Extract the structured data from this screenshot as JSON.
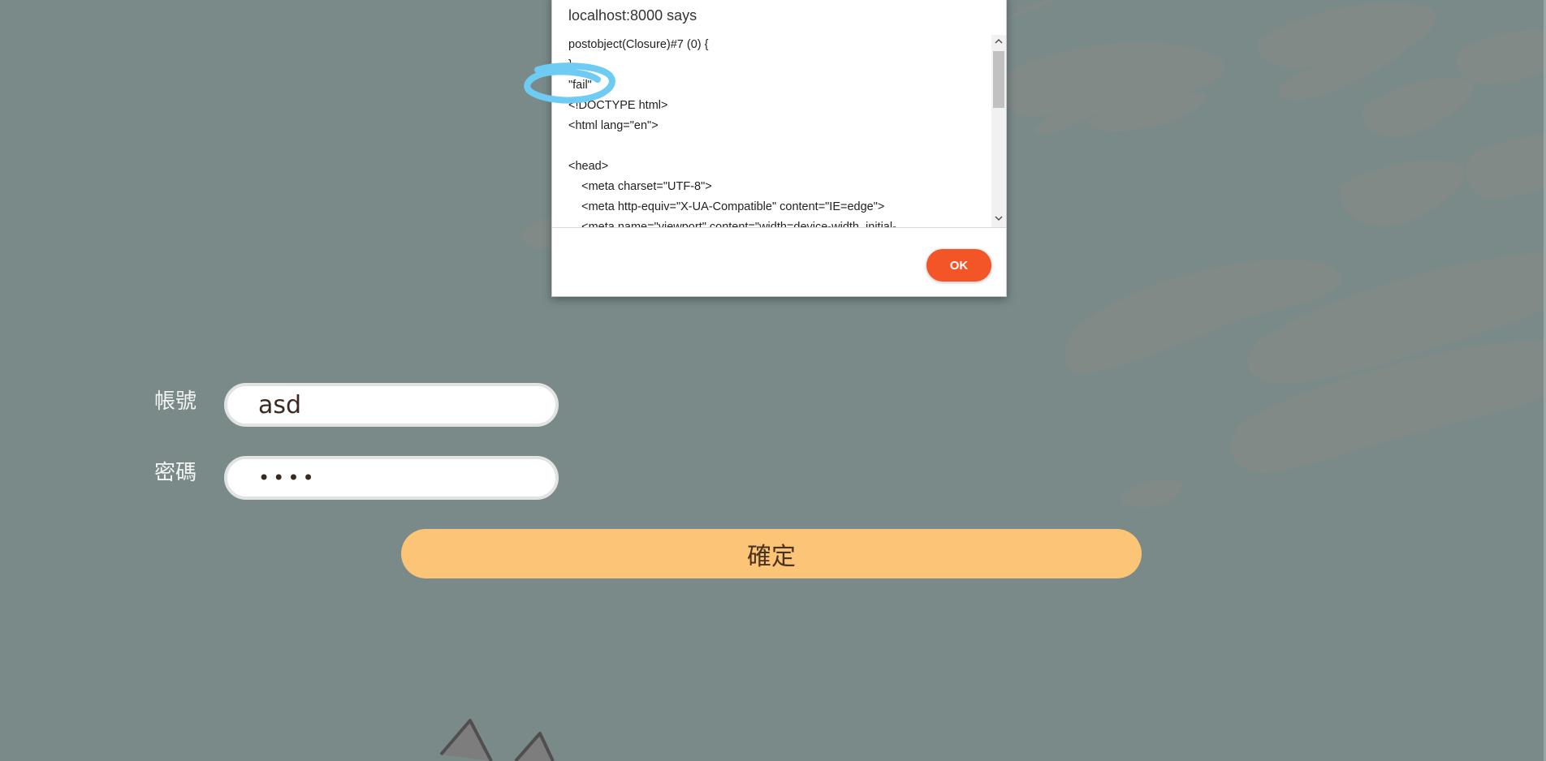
{
  "dialog": {
    "title": "localhost:8000 says",
    "message": "postobject(Closure)#7 (0) {\n}\n\"fail\"\n<!DOCTYPE html>\n<html lang=\"en\">\n\n<head>\n    <meta charset=\"UTF-8\">\n    <meta http-equiv=\"X-UA-Compatible\" content=\"IE=edge\">\n    <meta name=\"viewport\" content=\"width=device-width, initial-",
    "ok_label": "OK"
  },
  "form": {
    "account_label": "帳號",
    "account_value": "asd",
    "password_label": "密碼",
    "password_value": "asdf",
    "submit_label": "確定"
  },
  "colors": {
    "background": "#798a89",
    "submit_button": "#fcc477",
    "ok_button": "#f35526",
    "annotation": "#6ecbf3"
  },
  "icons": {
    "scroll_up": "chevron-up-icon",
    "scroll_down": "chevron-down-icon"
  }
}
